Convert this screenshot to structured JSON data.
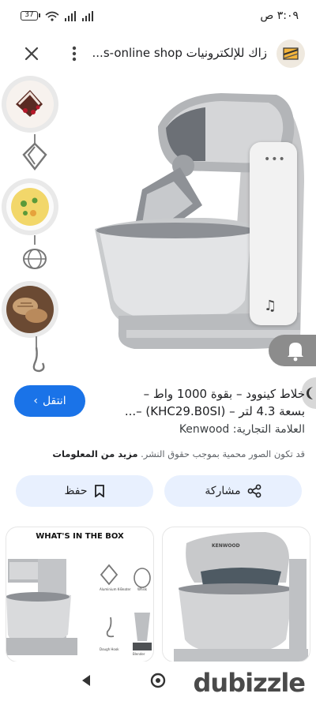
{
  "status_bar": {
    "time": "٣:٠٩ ص",
    "battery": "37"
  },
  "header": {
    "site_title": "زاك للإلكترونيات s-online shop..."
  },
  "product": {
    "title_line1": "خلاط كينوود – بقوة 1000 واط –",
    "title_line2": "بسعة 4.3 لتر – (KHC29.B0SI) –...",
    "brand": "العلامة التجارية: Kenwood",
    "copyright_text": "قد تكون الصور محمية بموجب حقوق النشر.",
    "more_info": "مزيد من المعلومات"
  },
  "actions": {
    "visit": "انتقل",
    "save": "حفظ",
    "share": "مشاركة"
  },
  "related": {
    "card1_heading": "WHAT'S IN THE BOX",
    "card1_labels": [
      "Aluminium K-Beater",
      "Whisk",
      "Dough Hook",
      "Blender"
    ],
    "card2_brand": "KENWOOD"
  },
  "watermark": "dubizzle",
  "icons": {
    "close": "close-icon",
    "more": "more-vertical-icon",
    "bell": "bell-icon",
    "music": "music-note-icon",
    "moon": "moon-icon"
  },
  "colors": {
    "accent": "#1a73e8",
    "chip_bg": "#e8f0fe"
  }
}
